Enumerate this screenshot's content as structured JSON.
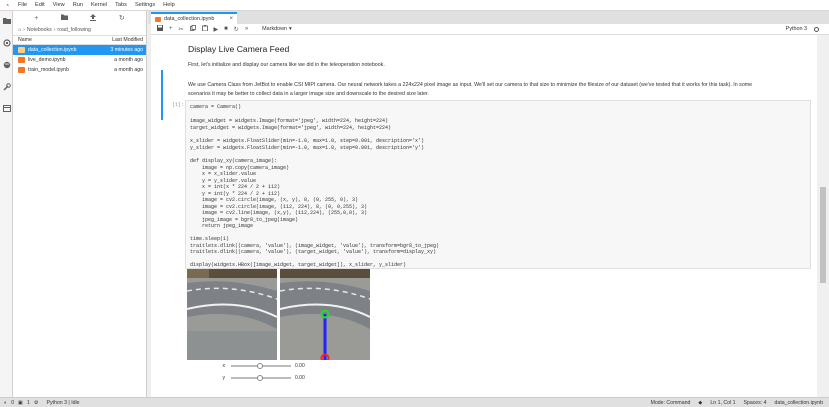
{
  "menubar": {
    "items": [
      "File",
      "Edit",
      "View",
      "Run",
      "Kernel",
      "Tabs",
      "Settings",
      "Help"
    ]
  },
  "filebrowser": {
    "breadcrumb": [
      "Notebooks",
      "road_following"
    ],
    "header": {
      "name": "Name",
      "modified": "Last Modified"
    },
    "files": [
      {
        "name": "data_collection.ipynb",
        "modified": "3 minutes ago",
        "selected": true
      },
      {
        "name": "live_demo.ipynb",
        "modified": "a month ago",
        "selected": false
      },
      {
        "name": "train_model.ipynb",
        "modified": "a month ago",
        "selected": false
      }
    ]
  },
  "tab": {
    "label": "data_collection.ipynb"
  },
  "toolbar": {
    "cell_type": "Markdown",
    "kernel": "Python 3"
  },
  "markdown": {
    "heading": "Display Live Camera Feed",
    "p1": "First, let's initialize and display our camera like we did in the teleoperation notebook.",
    "p2a": "We use Camera Class from JetBot to enable CSI MIPI camera. Our neural network takes a 224x224 pixel image as input. We'll set our camera to that size to minimize the filesize of our dataset (we've tested that it works for this task). In some",
    "p2b": "scenarios it may be better to collect data in a larger image size and downscale to the desired size later."
  },
  "code_cell": {
    "prompt": "[1]:",
    "lines": [
      "camera = Camera()",
      "",
      "image_widget = widgets.Image(format='jpeg', width=224, height=224)",
      "target_widget = widgets.Image(format='jpeg', width=224, height=224)",
      "",
      "x_slider = widgets.FloatSlider(min=-1.0, max=1.0, step=0.001, description='x')",
      "y_slider = widgets.FloatSlider(min=-1.0, max=1.0, step=0.001, description='y')",
      "",
      "def display_xy(camera_image):",
      "    image = np.copy(camera_image)",
      "    x = x_slider.value",
      "    y = y_slider.value",
      "    x = int(x * 224 / 2 + 112)",
      "    y = int(y * 224 / 2 + 112)",
      "    image = cv2.circle(image, (x, y), 8, (0, 255, 0), 3)",
      "    image = cv2.circle(image, (112, 224), 8, (0, 0,255), 3)",
      "    image = cv2.line(image, (x,y), (112,224), (255,0,0), 3)",
      "    jpeg_image = bgr8_to_jpeg(image)",
      "    return jpeg_image",
      "",
      "time.sleep(1)",
      "traitlets.dlink((camera, 'value'), (image_widget, 'value'), transform=bgr8_to_jpeg)",
      "traitlets.dlink((camera, 'value'), (target_widget, 'value'), transform=display_xy)",
      "",
      "display(widgets.HBox([image_widget, target_widget]), x_slider, y_slider)"
    ]
  },
  "sliders": [
    {
      "label": "x",
      "value": "0.00"
    },
    {
      "label": "y",
      "value": "0.00"
    }
  ],
  "statusbar": {
    "counts_a": "0",
    "counts_b": "1",
    "kernel": "Python 3 | Idle",
    "mode": "Mode: Command",
    "position": "Ln 1, Col 1",
    "spaces": "Spaces: 4",
    "file": "data_collection.ipynb"
  },
  "colors": {
    "accent": "#2196f3",
    "brand": "#f37726"
  }
}
